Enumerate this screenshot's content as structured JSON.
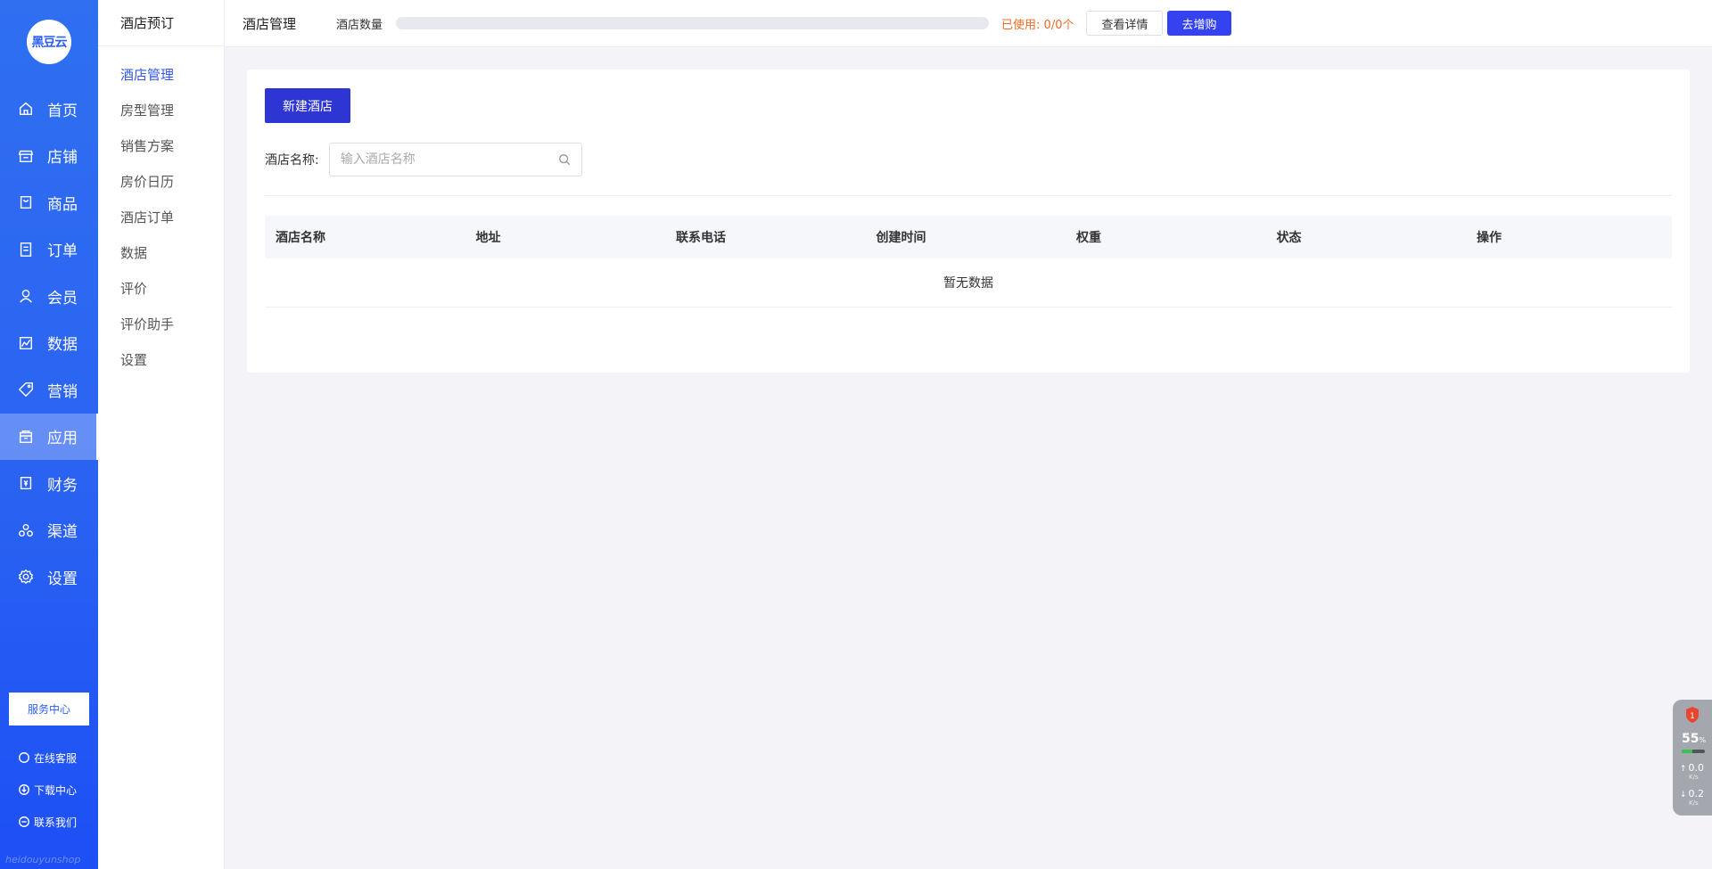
{
  "sidebar": {
    "logo": "黑豆云",
    "items": [
      {
        "label": "首页",
        "icon": "home-icon"
      },
      {
        "label": "店铺",
        "icon": "store-icon"
      },
      {
        "label": "商品",
        "icon": "goods-icon"
      },
      {
        "label": "订单",
        "icon": "order-icon"
      },
      {
        "label": "会员",
        "icon": "member-icon"
      },
      {
        "label": "数据",
        "icon": "chart-icon"
      },
      {
        "label": "营销",
        "icon": "tag-icon"
      },
      {
        "label": "应用",
        "icon": "app-icon",
        "active": true
      },
      {
        "label": "财务",
        "icon": "finance-icon"
      },
      {
        "label": "渠道",
        "icon": "channel-icon"
      },
      {
        "label": "设置",
        "icon": "gear-icon"
      }
    ],
    "service_center": "服务中心",
    "links": [
      {
        "label": "在线客服",
        "icon": "avatar-icon"
      },
      {
        "label": "下载中心",
        "icon": "download-icon"
      },
      {
        "label": "联系我们",
        "icon": "chat-icon"
      }
    ],
    "watermark": "heidouyunshop"
  },
  "subsidebar": {
    "title": "酒店预订",
    "items": [
      {
        "label": "酒店管理",
        "active": true
      },
      {
        "label": "房型管理"
      },
      {
        "label": "销售方案"
      },
      {
        "label": "房价日历"
      },
      {
        "label": "酒店订单"
      },
      {
        "label": "数据"
      },
      {
        "label": "评价"
      },
      {
        "label": "评价助手"
      },
      {
        "label": "设置"
      }
    ]
  },
  "topbar": {
    "title": "酒店管理",
    "count_label": "酒店数量",
    "usage_fraction": 0,
    "usage_text": "已使用: 0/0个",
    "detail_button": "查看详情",
    "buy_button": "去增购"
  },
  "main": {
    "new_button": "新建酒店",
    "filter_label": "酒店名称:",
    "search_placeholder": "输入酒店名称",
    "table": {
      "columns": [
        "酒店名称",
        "地址",
        "联系电话",
        "创建时间",
        "权重",
        "状态",
        "操作"
      ],
      "rows": [],
      "empty_text": "暂无数据"
    }
  },
  "monitor": {
    "badge": "1",
    "percent": "55",
    "percent_unit": "%",
    "level_fraction": 0.45,
    "up_value": "0.0",
    "down_value": "0.2",
    "rate_unit": "K/s"
  },
  "colors": {
    "accent": "#3458e8",
    "primary_button": "#2d36d3",
    "buy_button": "#3443ef",
    "usage_text": "#f06a22"
  }
}
